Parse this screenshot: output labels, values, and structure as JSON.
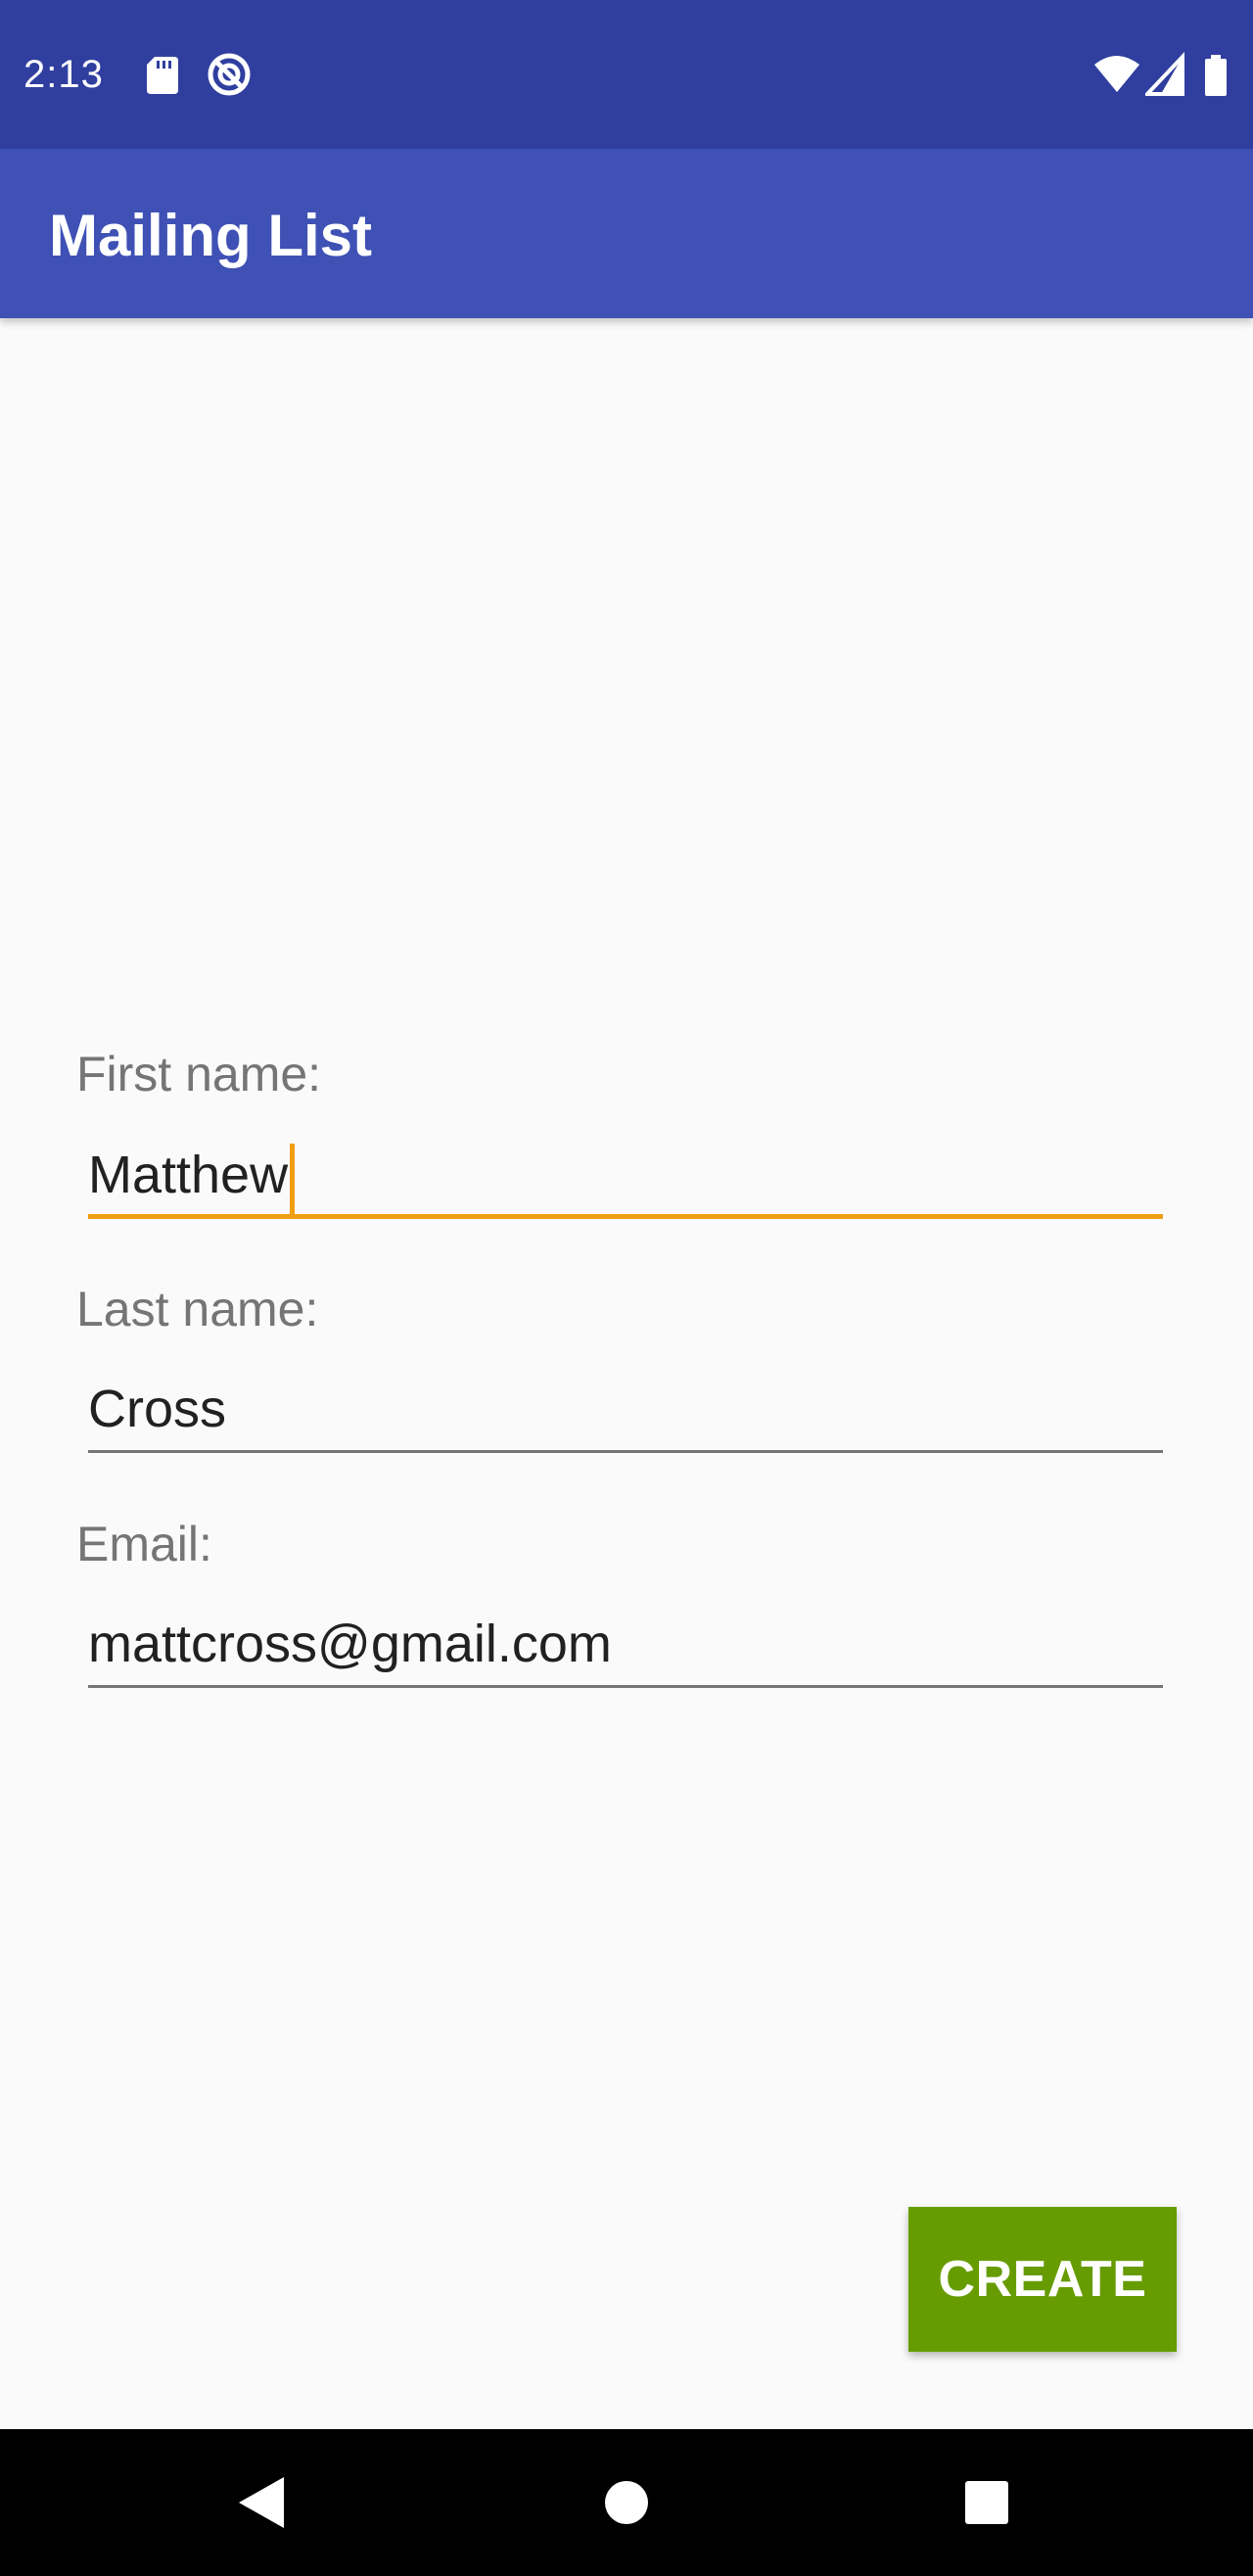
{
  "status_bar": {
    "time": "2:13",
    "icons": [
      "sd-card-icon",
      "do-not-disturb-icon",
      "wifi-icon",
      "cell-signal-icon",
      "battery-icon"
    ]
  },
  "app_bar": {
    "title": "Mailing List"
  },
  "form": {
    "first_name": {
      "label": "First name:",
      "value": "Matthew"
    },
    "last_name": {
      "label": "Last name:",
      "value": "Cross"
    },
    "email": {
      "label": "Email:",
      "value": "mattcross@gmail.com"
    }
  },
  "actions": {
    "create_label": "CREATE"
  },
  "nav_bar": {
    "icons": [
      "back-icon",
      "home-icon",
      "recents-icon"
    ]
  },
  "colors": {
    "status_bar": "#303f9f",
    "app_bar": "#3f51b5",
    "accent": "#f09e12",
    "button": "#669c00"
  }
}
